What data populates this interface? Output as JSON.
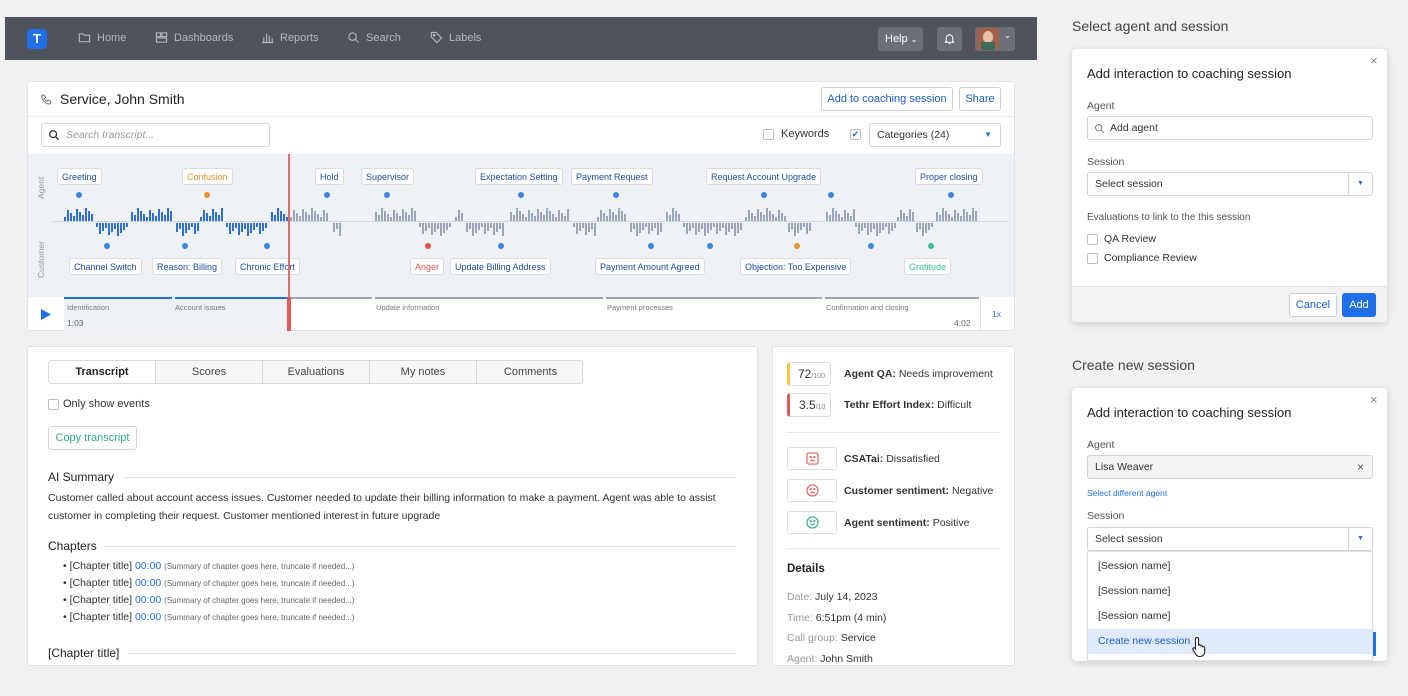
{
  "nav": {
    "logo": "T",
    "items": [
      {
        "label": "Home",
        "icon": "folder-icon"
      },
      {
        "label": "Dashboards",
        "icon": "dashboard-icon"
      },
      {
        "label": "Reports",
        "icon": "reports-icon"
      },
      {
        "label": "Search",
        "icon": "search-icon"
      },
      {
        "label": "Labels",
        "icon": "tag-icon"
      }
    ],
    "help": "Help"
  },
  "interaction": {
    "title": "Service, John Smith",
    "add_button": "Add to coaching session",
    "share_button": "Share",
    "search_placeholder": "Search transcript...",
    "keywords": "Keywords",
    "categories": "Categories (24)",
    "agent_row": "Agent",
    "customer_row": "Customer",
    "agent_labels": [
      "Greeting",
      "Confusion",
      "Hold",
      "Supervisor",
      "Expectation Setting",
      "Payment Request",
      "Request Account Upgrade",
      "Proper closing"
    ],
    "customer_labels": [
      "Channel Switch",
      "Reason: Billing",
      "Chronic Effort",
      "Anger",
      "Update Billing Address",
      "Payment Amount Agreed",
      "Objection: Too Expensive",
      "Gratitude"
    ],
    "segments": [
      "Identification",
      "Account issues",
      "Update information",
      "Payment processes",
      "Confirmation and closing"
    ],
    "time_current": "1:03",
    "time_total": "4:02",
    "speed": "1x"
  },
  "tabs": [
    "Transcript",
    "Scores",
    "Evaluations",
    "My notes",
    "Comments"
  ],
  "transcript": {
    "only_events": "Only show events",
    "copy": "Copy transcript",
    "summary_heading": "AI Summary",
    "summary_text": "Customer called about account access issues. Customer needed to update their billing information to make a payment. Agent was able to assist customer in completing their request. Customer mentioned interest in future upgrade",
    "chapters_heading": "Chapters",
    "chapters": [
      {
        "title": "[Chapter title]",
        "time": "00:00",
        "summary": "(Summary of chapter goes here, truncate if needed...)"
      },
      {
        "title": "[Chapter title]",
        "time": "00:00",
        "summary": "(Summary of chapter goes here, truncate if needed...)"
      },
      {
        "title": "[Chapter title]",
        "time": "00:00",
        "summary": "(Summary of chapter goes here, truncate if needed...)"
      },
      {
        "title": "[Chapter title]",
        "time": "00:00",
        "summary": "(Summary of chapter goes here, truncate if needed...)"
      }
    ],
    "chapter_heading": "[Chapter title]"
  },
  "scores": {
    "qa": {
      "value": "72",
      "max": "/100",
      "label": "Agent QA:",
      "status": "Needs improvement",
      "color": "#f5c842"
    },
    "effort": {
      "value": "3.5",
      "max": "/10",
      "label": "Tethr Effort Index:",
      "status": "Difficult",
      "color": "#e05b5b"
    },
    "csat": {
      "label": "CSATai:",
      "status": "Dissatisfied"
    },
    "customer_sentiment": {
      "label": "Customer sentiment:",
      "status": "Negative"
    },
    "agent_sentiment": {
      "label": "Agent sentiment:",
      "status": "Positive"
    },
    "details_heading": "Details",
    "details": [
      {
        "key": "Date:",
        "value": "July 14, 2023"
      },
      {
        "key": "Time:",
        "value": "6:51pm (4 min)"
      },
      {
        "key": "Call group:",
        "value": "Service"
      },
      {
        "key": "Agent:",
        "value": "John Smith"
      }
    ]
  },
  "modal1": {
    "section_title": "Select agent and session",
    "title": "Add interaction to coaching session",
    "agent_label": "Agent",
    "agent_placeholder": "Add agent",
    "session_label": "Session",
    "session_value": "Select session",
    "eval_label": "Evaluations to link to the this session",
    "evals": [
      "QA Review",
      "Compliance Review"
    ],
    "cancel": "Cancel",
    "add": "Add"
  },
  "modal2": {
    "section_title": "Create new session",
    "title": "Add interaction to coaching session",
    "agent_label": "Agent",
    "agent_value": "Lisa Weaver",
    "change_agent": "Select different agent",
    "session_label": "Session",
    "session_value": "Select session",
    "options": [
      "[Session name]",
      "[Session name]",
      "[Session name]"
    ],
    "create": "Create new session"
  }
}
